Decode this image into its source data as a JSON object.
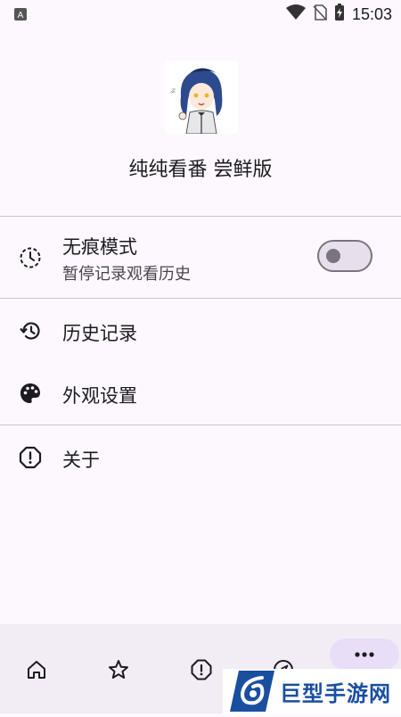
{
  "status_bar": {
    "notification_icon": "A",
    "time": "15:03",
    "icons": [
      "wifi-icon",
      "no-sim-icon",
      "battery-charging-icon"
    ]
  },
  "header": {
    "app_name": "纯纯看番 尝鲜版",
    "avatar": "anime-girl-avatar"
  },
  "menu": {
    "incognito": {
      "title": "无痕模式",
      "subtitle": "暂停记录观看历史",
      "icon": "incognito-timer-icon",
      "enabled": false
    },
    "history": {
      "title": "历史记录",
      "icon": "history-icon"
    },
    "appearance": {
      "title": "外观设置",
      "icon": "palette-icon"
    },
    "about": {
      "title": "关于",
      "icon": "info-alert-icon"
    }
  },
  "bottom_nav": {
    "items": [
      "home-icon",
      "star-icon",
      "alert-icon",
      "compass-icon",
      "more-icon"
    ],
    "active": "more-icon"
  },
  "watermark": {
    "text": "巨型手游网"
  },
  "colors": {
    "background": "#fdf8fe",
    "nav_background": "#f2ecf4",
    "active_pill": "#e8def8",
    "divider": "#c9c5cc",
    "text_primary": "#1c1b1f",
    "text_secondary": "#49454f",
    "watermark_blue": "#1a4fa0"
  }
}
